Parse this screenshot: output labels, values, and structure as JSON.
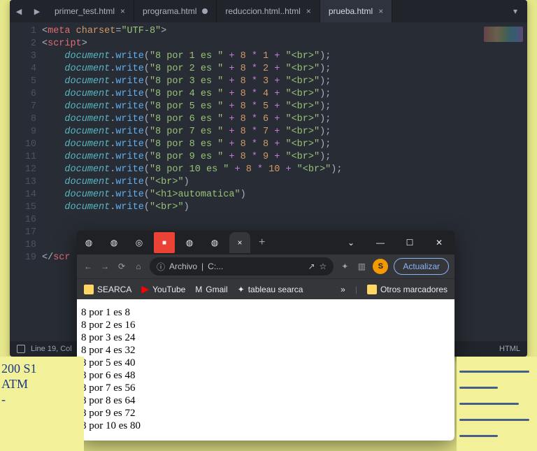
{
  "editor": {
    "tabs": [
      {
        "label": "primer_test.html",
        "state": "open"
      },
      {
        "label": "programa.html",
        "state": "dirty"
      },
      {
        "label": "reduccion.html..html",
        "state": "open"
      },
      {
        "label": "prueba.html",
        "state": "active"
      }
    ],
    "gutter": [
      "1",
      "2",
      "3",
      "4",
      "5",
      "6",
      "7",
      "8",
      "9",
      "10",
      "11",
      "12",
      "13",
      "14",
      "15",
      "16",
      "17",
      "18",
      "19"
    ],
    "lines": {
      "l1": {
        "tag_open": "<",
        "tag": "meta",
        "attr": "charset",
        "eq": "=",
        "val": "\"UTF-8\"",
        "close": ">"
      },
      "l2": {
        "tag_open": "<",
        "tag": "script",
        "close": ">"
      },
      "dw": [
        {
          "n": "1",
          "label": "\"8 por 1 es \"",
          "mul": "1"
        },
        {
          "n": "2",
          "label": "\"8 por 2 es \"",
          "mul": "2"
        },
        {
          "n": "3",
          "label": "\"8 por 3 es \"",
          "mul": "3"
        },
        {
          "n": "4",
          "label": "\"8 por 4 es \"",
          "mul": "4"
        },
        {
          "n": "5",
          "label": "\"8 por 5 es \"",
          "mul": "5"
        },
        {
          "n": "6",
          "label": "\"8 por 6 es \"",
          "mul": "6"
        },
        {
          "n": "7",
          "label": "\"8 por 7 es \"",
          "mul": "7"
        },
        {
          "n": "8",
          "label": "\"8 por 8 es \"",
          "mul": "8"
        },
        {
          "n": "9",
          "label": "\"8 por 9 es \"",
          "mul": "9"
        },
        {
          "n": "10",
          "label": "\"8 por 10 es \"",
          "mul": "10"
        }
      ],
      "eight": "8",
      "star": "*",
      "plus": "+",
      "br_lit": "\"<br>\"",
      "after": [
        {
          "arg": "\"<br>\""
        },
        {
          "arg": "\"<h1>automatica\""
        },
        {
          "arg": "\"<br>\""
        }
      ],
      "doc": "document",
      "write": "write",
      "close_script": "</script"
    },
    "status": {
      "text": "Line 19, Col",
      "lang": "HTML"
    }
  },
  "browser": {
    "tabs_icons": [
      "◍",
      "◍",
      "◎",
      "■",
      "◍",
      "◍"
    ],
    "active_tab_close": "×",
    "plus": "+",
    "win": {
      "min": "—",
      "max": "☐",
      "close": "✕",
      "chevron": "⌄"
    },
    "nav": {
      "back": "←",
      "fwd": "→",
      "reload": "⟳",
      "home": "⌂"
    },
    "addr": {
      "info": "ⓘ",
      "label": "Archivo",
      "sep": "|",
      "path": "C:...",
      "share": "↗",
      "star": "☆"
    },
    "ext": "✦",
    "tile": "▥",
    "avatar_letter": "S",
    "update_label": "Actualizar",
    "bookmarks": {
      "items": [
        {
          "icon": "folder",
          "label": "SEARCA"
        },
        {
          "icon": "yt",
          "label": "YouTube"
        },
        {
          "icon": "gm",
          "label": "Gmail"
        },
        {
          "icon": "tb",
          "label": "tableau searca"
        }
      ],
      "overflow": "»",
      "other": "Otros marcadores"
    },
    "page_lines": [
      "8 por 1 es 8",
      "8 por 2 es 16",
      "8 por 3 es 24",
      "8 por 4 es 32",
      "8 por 5 es 40",
      "8 por 6 es 48",
      "8 por 7 es 56",
      "8 por 8 es 64",
      "8 por 9 es 72",
      "8 por 10 es 80"
    ]
  },
  "paper_left": [
    "200 S1",
    "  ATM",
    "   -"
  ],
  "icons": {
    "triangle_left": "◀",
    "triangle_right": "▶",
    "dropdown": "▾"
  }
}
